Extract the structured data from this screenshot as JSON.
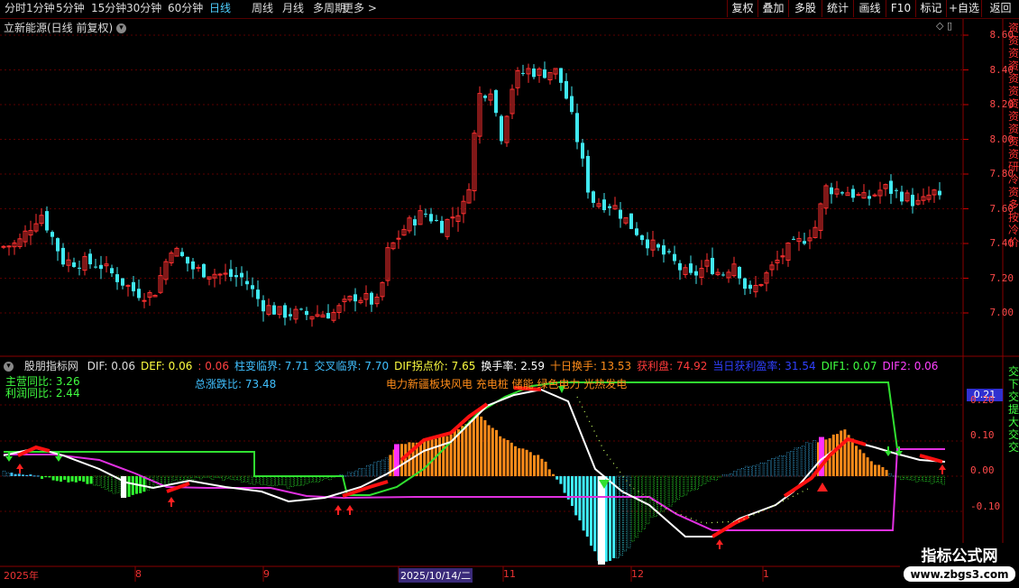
{
  "toolbar": {
    "periods": [
      "分时",
      "1分钟",
      "5分钟",
      "15分钟",
      "30分钟",
      "60分钟",
      "日线",
      "周线",
      "月线",
      "多周期",
      "更多 >"
    ],
    "active_period": "日线",
    "right_buttons": [
      "复权",
      "叠加",
      "多股",
      "统计",
      "画线",
      "F10",
      "标记",
      "+自选",
      "返回"
    ]
  },
  "main_chart": {
    "title": "立新能源(日线 前复权)",
    "y_ticks": [
      "8.60",
      "8.40",
      "8.20",
      "8.00",
      "7.80",
      "7.60",
      "7.40",
      "7.20",
      "7.00"
    ],
    "up_color": "#ff3030",
    "down_color": "#40e8f0"
  },
  "indicator": {
    "name": "股朋指标网",
    "fields": [
      {
        "label": "DIF: 0.06",
        "color": "#dddddd"
      },
      {
        "label": "DEF: 0.06",
        "color": "#ffff40"
      },
      {
        "label": ": 0.06",
        "color": "#ff4040"
      },
      {
        "label": "柱变临界: 7.71",
        "color": "#40c0ff"
      },
      {
        "label": "交叉临界: 7.70",
        "color": "#40c0ff"
      },
      {
        "label": "DIF拐点价: 7.65",
        "color": "#ffff40"
      },
      {
        "label": "换手率: 2.59",
        "color": "#ffffff"
      },
      {
        "label": "十日换手: 13.53",
        "color": "#ff8c1a"
      },
      {
        "label": "获利盘: 74.92",
        "color": "#ff3b3b"
      },
      {
        "label": "当日获利盈率: 31.54",
        "color": "#3040ff"
      },
      {
        "label": "DIF1: 0.07",
        "color": "#40ff40"
      },
      {
        "label": "DIF2: 0.06",
        "color": "#ff40ff"
      }
    ],
    "main_yoy": "主营同比: 3.26",
    "profit_yoy": "利润同比: 2.44",
    "up_down_ratio": "总涨跌比: 73.48",
    "sector": "电力新疆板块风电 充电桩 储能 绿色电力 光热发电",
    "y_ticks": [
      "0.20",
      "0.10",
      "0.00",
      "-0.10"
    ],
    "current_value": "0.21"
  },
  "side_labels_top": [
    "资",
    "资",
    "资",
    "资",
    "资",
    "资",
    "资",
    "资",
    "资",
    "资",
    "资",
    "研",
    "冷",
    "资",
    "多",
    "按",
    "冷",
    "价"
  ],
  "side_labels_bottom": [
    "交",
    "下",
    "交",
    "提",
    "大",
    "交",
    "交"
  ],
  "x_axis": {
    "labels": [
      "2025年",
      "8",
      "9",
      "2025/10/14/二",
      "11",
      "12",
      "1"
    ]
  },
  "watermark": {
    "title": "指标公式网",
    "url": "www.zbgs3.com"
  }
}
